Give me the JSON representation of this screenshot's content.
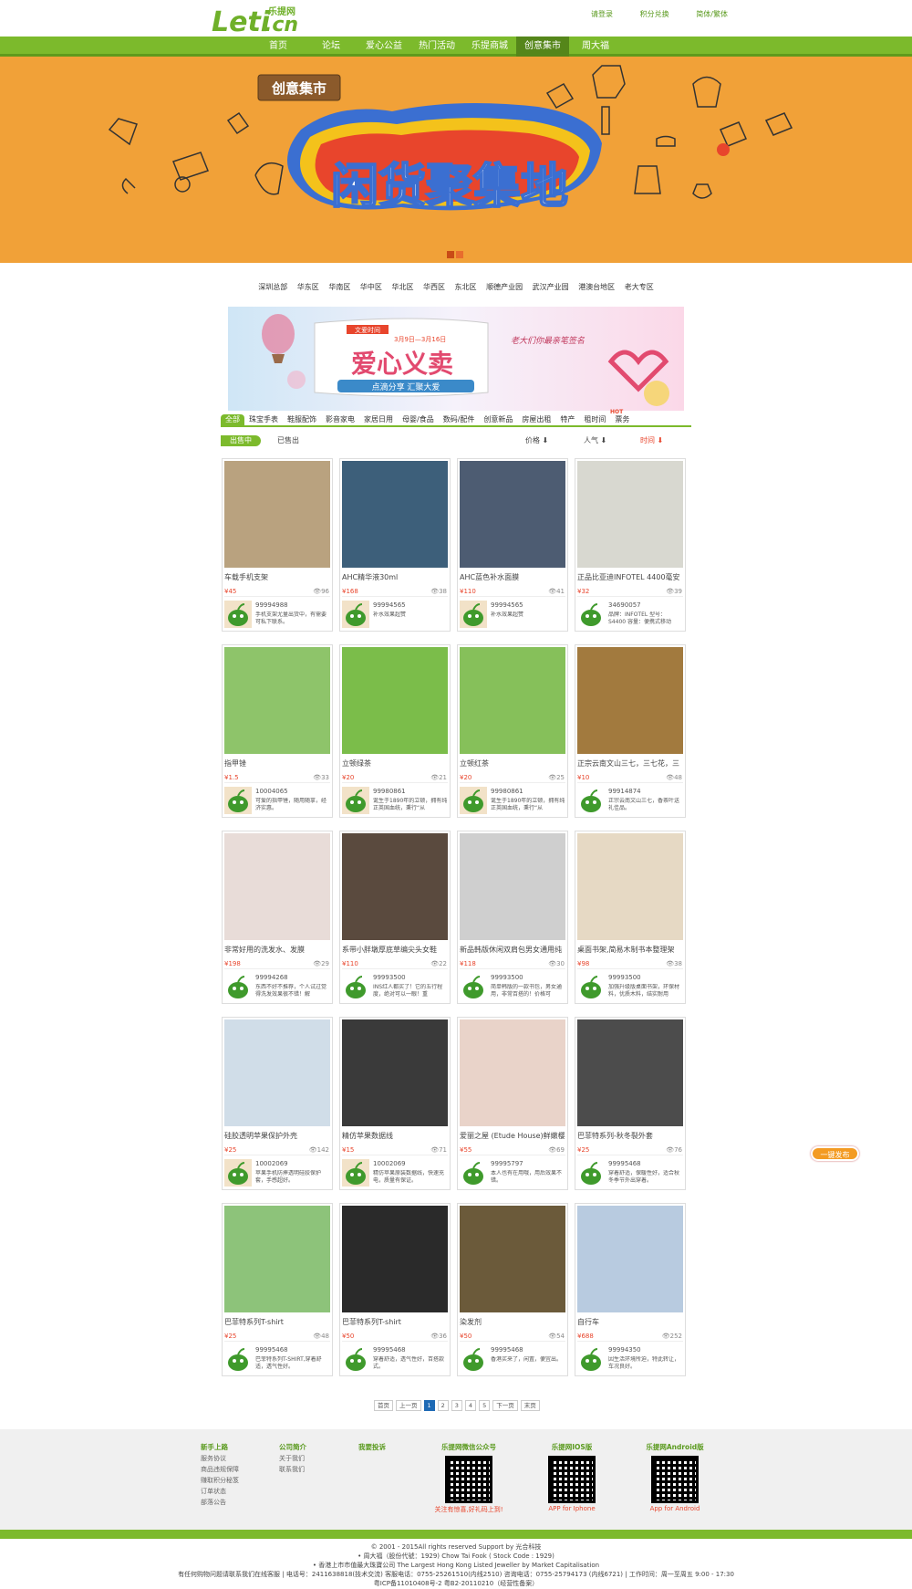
{
  "header": {
    "logo_text": "Leti",
    "logo_cn": "乐提网",
    "logo_domain": ".cn",
    "links": [
      "请登录",
      "积分兑换",
      "简体/繁体"
    ]
  },
  "nav": [
    "首页",
    "论坛",
    "爱心公益",
    "热门活动",
    "乐提商城",
    "创意集市",
    "周大福"
  ],
  "banner": {
    "sign": "创意集市",
    "title": "闲货聚集地"
  },
  "regions": [
    "深圳总部",
    "华东区",
    "华南区",
    "华中区",
    "华北区",
    "华西区",
    "东北区",
    "顺德产业园",
    "武汉产业园",
    "港澳台地区",
    "老大专区"
  ],
  "promo": {
    "tag": "文爱时间",
    "dates": "3月9日—3月16日",
    "title": "爱心义卖",
    "slogan": "点滴分享 汇聚大爱",
    "right_text": "老大们你最亲笔签名"
  },
  "categories": [
    "全部",
    "珠宝手表",
    "鞋服配饰",
    "影音家电",
    "家居日用",
    "母婴/食品",
    "数码/配件",
    "创意新品",
    "房屋出租",
    "特产",
    "租时间",
    "票务"
  ],
  "hot_label": "HOT",
  "status_tabs": {
    "on": "出售中",
    "off": "已售出"
  },
  "sort": {
    "price": "价格 ⬇",
    "popularity": "人气 ⬇",
    "time": "时间 ⬇"
  },
  "products": [
    {
      "title": "车载手机支架",
      "price": "¥45",
      "views": "96",
      "uid": "99994988",
      "desc": "手机支架尤量出货中，有需要可私下联系。"
    },
    {
      "title": "AHC精华液30ml",
      "price": "¥168",
      "views": "38",
      "uid": "99994565",
      "desc": "补水效果超赞"
    },
    {
      "title": "AHC蓝色补水面膜",
      "price": "¥110",
      "views": "41",
      "uid": "99994565",
      "desc": "补水效果超赞"
    },
    {
      "title": "正品比亚迪INFOTEL 4400毫安",
      "price": "¥32",
      "views": "39",
      "uid": "34690057",
      "desc": "品牌：INFOTEL 型号：S4400 容量：便携式移动"
    },
    {
      "title": "指甲锉",
      "price": "¥1.5",
      "views": "33",
      "uid": "10004065",
      "desc": "可爱的指甲锉，随用随拿，经济实惠。"
    },
    {
      "title": "立顿绿茶",
      "price": "¥20",
      "views": "21",
      "uid": "99980861",
      "desc": "诞生于1890年的立顿，拥有纯正英国血统，秉行“从"
    },
    {
      "title": "立顿红茶",
      "price": "¥20",
      "views": "25",
      "uid": "99980861",
      "desc": "诞生于1890年的立顿，拥有纯正英国血统，秉行“从"
    },
    {
      "title": "正宗云南文山三七，三七花，三",
      "price": "¥10",
      "views": "48",
      "uid": "99914874",
      "desc": "正宗云南文山三七，香茶叶送礼佳品。"
    },
    {
      "title": "非常好用的洗发水、发膜",
      "price": "¥198",
      "views": "29",
      "uid": "99994268",
      "desc": "东西不好不推荐，个人试过觉得洗发效果很不错！解"
    },
    {
      "title": "系带小胖墩厚底草编尖头女鞋",
      "price": "¥110",
      "views": "22",
      "uid": "99993500",
      "desc": "INS红人都买了！它的五行程度，绝对可以一眼！重"
    },
    {
      "title": "新品韩版休闲双肩包男女通用纯",
      "price": "¥118",
      "views": "30",
      "uid": "99993500",
      "desc": "简单韩版的一款书包，男女通用，非常百搭的！价格可"
    },
    {
      "title": "桌面书架,简易木制书本整理架",
      "price": "¥98",
      "views": "38",
      "uid": "99993500",
      "desc": "加强升级版桌面书架，环保材料，优质木料，结实耐用"
    },
    {
      "title": "硅胶透明苹果保护外壳",
      "price": "¥25",
      "views": "142",
      "uid": "10002069",
      "desc": "苹果手机防摔透明硅胶保护套，手感超好。"
    },
    {
      "title": "精仿苹果数据线",
      "price": "¥15",
      "views": "71",
      "uid": "10002069",
      "desc": "精仿苹果原装数据线，快速充电，质量有保证。"
    },
    {
      "title": "爱丽之屋 (Etude House)鲜嫩樱",
      "price": "¥55",
      "views": "69",
      "uid": "99995797",
      "desc": "本人也有在用哦，用后效果不错。"
    },
    {
      "title": "巴菲特系列-秋冬裂外套",
      "price": "¥25",
      "views": "76",
      "uid": "99995468",
      "desc": "穿着舒适，保暖性好，适合秋冬季节外出穿着。"
    },
    {
      "title": "巴菲特系列T-shirt",
      "price": "¥25",
      "views": "48",
      "uid": "99995468",
      "desc": "巴菲特系列T-SHIRT,穿着舒适，透气性好。"
    },
    {
      "title": "巴菲特系列T-shirt",
      "price": "¥50",
      "views": "36",
      "uid": "99995468",
      "desc": "穿着舒适，透气性好，百搭款式。"
    },
    {
      "title": "染发剂",
      "price": "¥50",
      "views": "54",
      "uid": "99995468",
      "desc": "香港买来了，闲置，便宜出。"
    },
    {
      "title": "自行车",
      "price": "¥688",
      "views": "252",
      "uid": "99994350",
      "desc": "因生活环境所迫，特此转让，车况良好。"
    }
  ],
  "pager": [
    "首页",
    "上一页",
    "1",
    "2",
    "3",
    "4",
    "5",
    "下一页",
    "末页"
  ],
  "float_btn": "一键发布",
  "footer": {
    "cols": [
      {
        "h": "新手上路",
        "items": [
          "服务协议",
          "商品违规保障",
          "赚取积分秘笈",
          "订单状态",
          "部落公告"
        ]
      },
      {
        "h": "公司简介",
        "items": [
          "关于我们",
          "联系我们"
        ]
      },
      {
        "h": "我要投诉",
        "items": []
      }
    ],
    "qrs": [
      {
        "h": "乐提网微信公众号",
        "cap": "关注有惊喜,好礼码上到!"
      },
      {
        "h": "乐提网IOS版",
        "cap": "APP for Iphone"
      },
      {
        "h": "乐提网Android版",
        "cap": "App for Android"
      }
    ],
    "copy": [
      "© 2001 - 2015All rights reserved Support by 光合科技",
      "• 周大福（股份代號：1929) Chow Tai Fook ( Stock Code : 1929)",
      "• 香港上市市值最大珠寶公司 The Largest Hong Kong Listed Jeweller by Market Capitalisation",
      "有任何购物问题请联系我们在线客服 | 电话号：2411638818(技术交流) 客服电话：0755-25261510(内线2510) 咨询电话：0755-25794173 (内线6721) | 工作时间：周一至周五 9:00 - 17:30",
      "粤ICP备11010408号-2 粤B2-20110210（经营性备案）"
    ]
  },
  "colors": {
    "green": "#7cba2c",
    "orange": "#f1a138",
    "red": "#e8452c"
  }
}
